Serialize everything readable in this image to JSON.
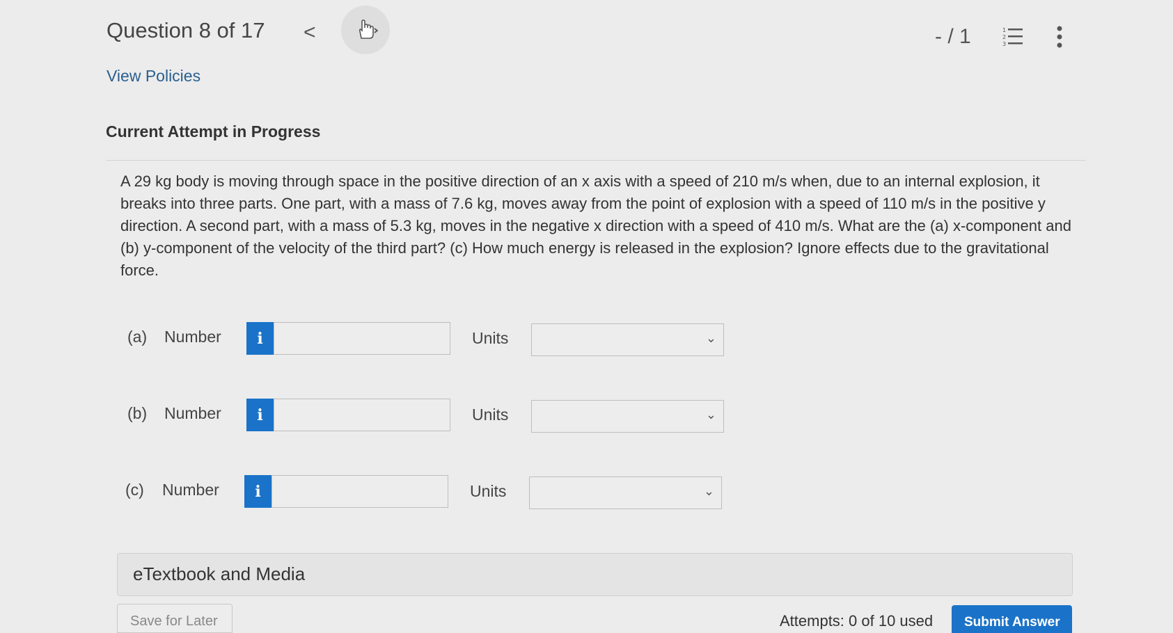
{
  "header": {
    "question_label": "Question 8 of 17",
    "prev_glyph": "<",
    "score": "- / 1",
    "icons": {
      "prev": "chevron-left-icon",
      "next": "pointer-hand-icon",
      "list": "numbered-list-icon",
      "more": "kebab-menu-icon"
    }
  },
  "links": {
    "view_policies": "View Policies"
  },
  "attempt": {
    "label": "Current Attempt in Progress"
  },
  "question": {
    "text": "A 29 kg body is moving through space in the positive direction of an x axis with a speed of 210 m/s when, due to an internal explosion, it breaks into three parts. One part, with a mass of 7.6 kg, moves away from the point of explosion with a speed of 110 m/s in the positive y direction. A second part, with a mass of 5.3 kg, moves in the negative x direction with a speed of 410 m/s. What are the (a) x-component and (b) y-component of the velocity of the third part? (c) How much energy is released in the explosion? Ignore effects due to the gravitational force."
  },
  "answers": [
    {
      "part": "(a)",
      "number_label": "Number",
      "info_glyph": "i",
      "value": "",
      "units_label": "Units",
      "units_selected": ""
    },
    {
      "part": "(b)",
      "number_label": "Number",
      "info_glyph": "i",
      "value": "",
      "units_label": "Units",
      "units_selected": ""
    },
    {
      "part": "(c)",
      "number_label": "Number",
      "info_glyph": "i",
      "value": "",
      "units_label": "Units",
      "units_selected": ""
    }
  ],
  "footer": {
    "etextbook": "eTextbook and Media",
    "save_later": "Save for Later",
    "attempts": "Attempts: 0 of 10 used",
    "submit": "Submit Answer"
  },
  "colors": {
    "accent": "#1a73c8",
    "link": "#2b5f8f",
    "background": "#ececec"
  }
}
